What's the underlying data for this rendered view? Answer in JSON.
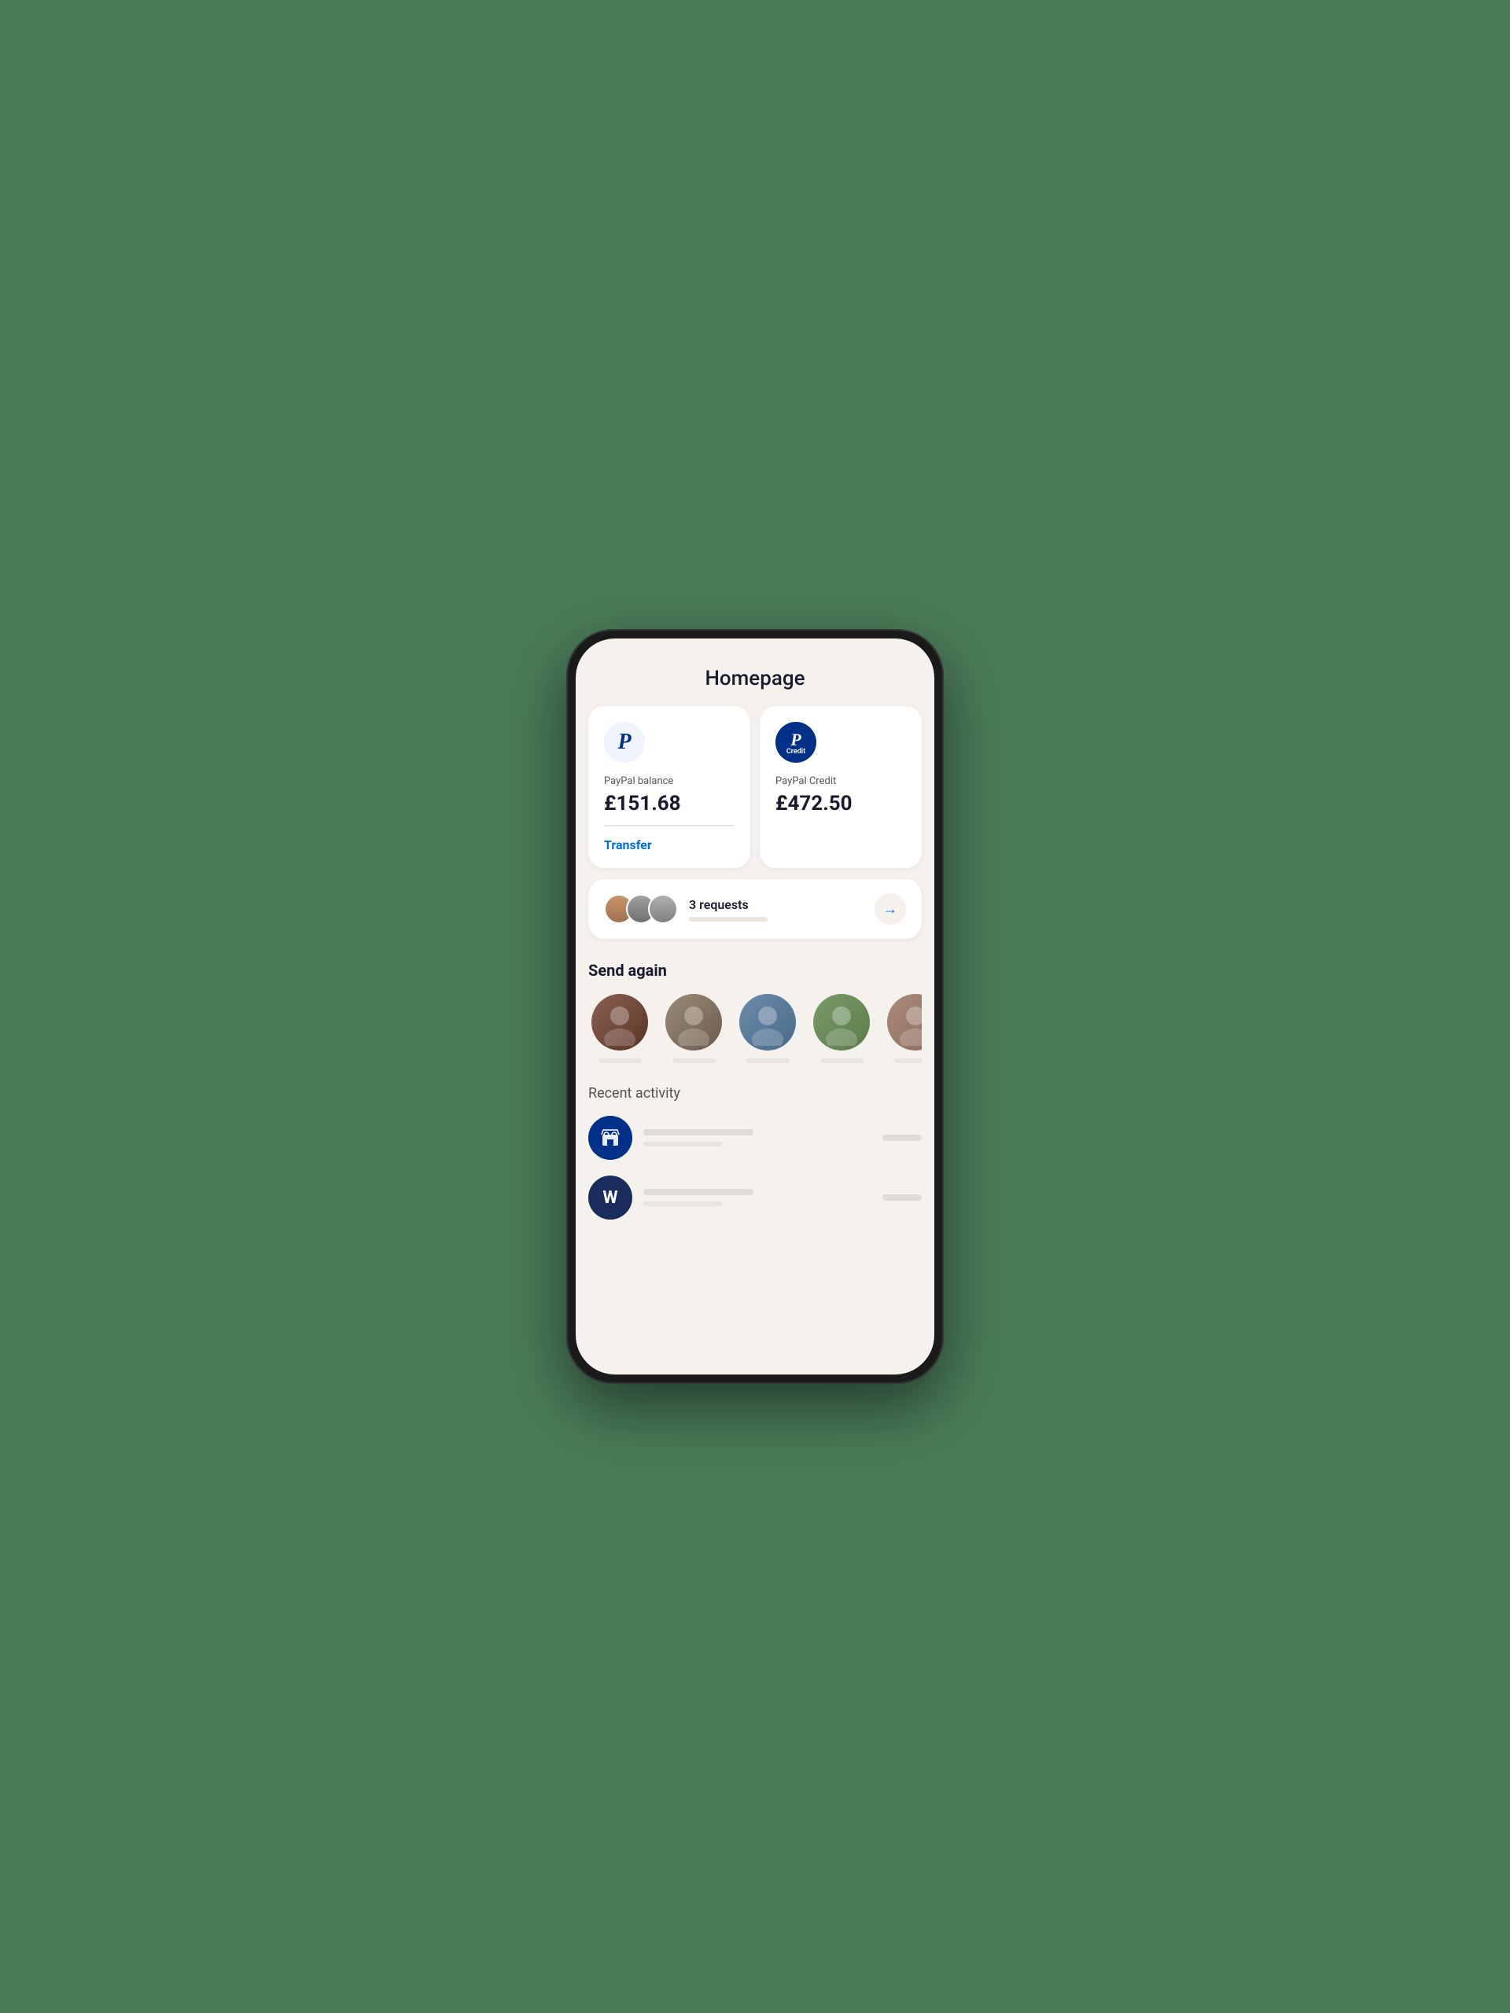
{
  "page": {
    "title": "Homepage",
    "background": "#4a7c59"
  },
  "balance_cards": [
    {
      "id": "paypal-balance",
      "logo_type": "paypal_white",
      "subtitle": "PayPal balance",
      "amount": "£151.68",
      "has_transfer": true,
      "transfer_label": "Transfer"
    },
    {
      "id": "paypal-credit",
      "logo_type": "paypal_dark",
      "subtitle": "PayPal Credit",
      "amount": "£472.50",
      "has_transfer": false,
      "credit_text": "Credit"
    }
  ],
  "requests": {
    "count_label": "3 requests",
    "arrow": "→"
  },
  "send_again": {
    "title": "Send again",
    "contacts": [
      {
        "id": 1,
        "class": "sa1"
      },
      {
        "id": 2,
        "class": "sa2"
      },
      {
        "id": 3,
        "class": "sa3"
      },
      {
        "id": 4,
        "class": "sa4"
      },
      {
        "id": 5,
        "class": "sa5"
      }
    ]
  },
  "recent_activity": {
    "title": "Recent activity",
    "items": [
      {
        "id": 1,
        "icon_type": "store",
        "letter": ""
      },
      {
        "id": 2,
        "icon_type": "letter",
        "letter": "W"
      }
    ]
  }
}
